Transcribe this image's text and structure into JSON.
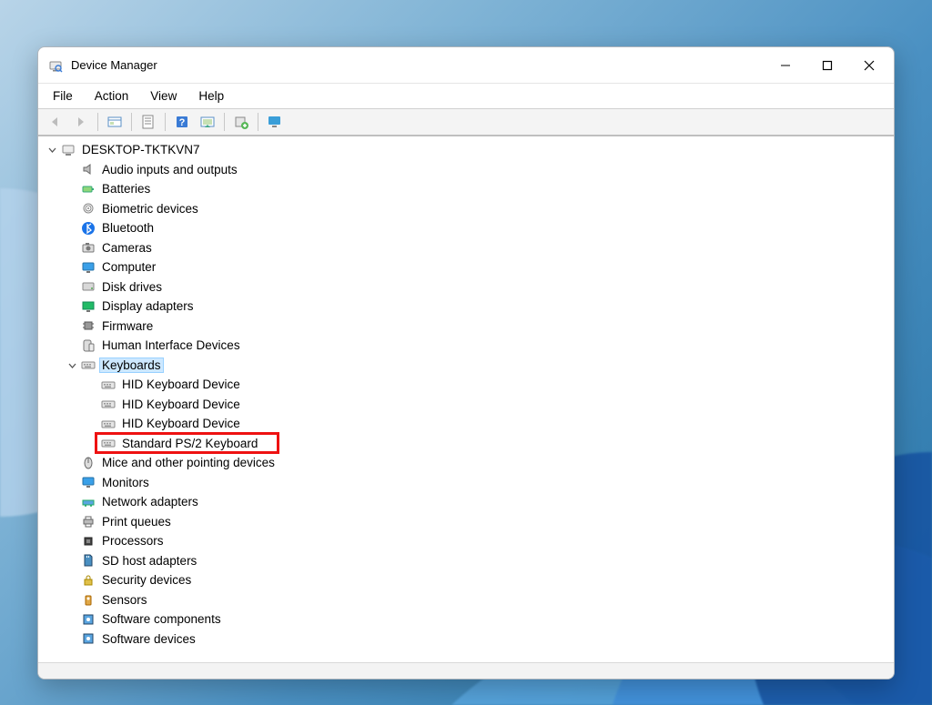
{
  "window": {
    "title": "Device Manager"
  },
  "menu": {
    "file": "File",
    "action": "Action",
    "view": "View",
    "help": "Help"
  },
  "toolbar": {
    "back": "back",
    "forward": "forward",
    "show_hidden": "show-hidden",
    "properties": "properties",
    "help": "help",
    "scan": "scan-hardware-changes",
    "add_driver": "add-driver",
    "monitor": "remote-monitor"
  },
  "tree": {
    "root": {
      "label": "DESKTOP-TKTKVN7",
      "expanded": true,
      "children": [
        {
          "label": "Audio inputs and outputs",
          "icon": "speaker",
          "expanded": false
        },
        {
          "label": "Batteries",
          "icon": "battery",
          "expanded": false
        },
        {
          "label": "Biometric devices",
          "icon": "fingerprint",
          "expanded": false
        },
        {
          "label": "Bluetooth",
          "icon": "bluetooth",
          "expanded": false
        },
        {
          "label": "Cameras",
          "icon": "camera",
          "expanded": false
        },
        {
          "label": "Computer",
          "icon": "monitor",
          "expanded": false
        },
        {
          "label": "Disk drives",
          "icon": "disk",
          "expanded": false
        },
        {
          "label": "Display adapters",
          "icon": "display",
          "expanded": false
        },
        {
          "label": "Firmware",
          "icon": "chip",
          "expanded": false
        },
        {
          "label": "Human Interface Devices",
          "icon": "hid",
          "expanded": false
        },
        {
          "label": "Keyboards",
          "icon": "keyboard",
          "expanded": true,
          "selected": true,
          "children": [
            {
              "label": "HID Keyboard Device",
              "icon": "keyboard"
            },
            {
              "label": "HID Keyboard Device",
              "icon": "keyboard"
            },
            {
              "label": "HID Keyboard Device",
              "icon": "keyboard"
            },
            {
              "label": "Standard PS/2 Keyboard",
              "icon": "keyboard",
              "highlighted": true
            }
          ]
        },
        {
          "label": "Mice and other pointing devices",
          "icon": "mouse",
          "expanded": false
        },
        {
          "label": "Monitors",
          "icon": "monitor",
          "expanded": false
        },
        {
          "label": "Network adapters",
          "icon": "network",
          "expanded": false
        },
        {
          "label": "Print queues",
          "icon": "printer",
          "expanded": false
        },
        {
          "label": "Processors",
          "icon": "cpu",
          "expanded": false
        },
        {
          "label": "SD host adapters",
          "icon": "sd",
          "expanded": false
        },
        {
          "label": "Security devices",
          "icon": "lock",
          "expanded": false
        },
        {
          "label": "Sensors",
          "icon": "sensor",
          "expanded": false
        },
        {
          "label": "Software components",
          "icon": "software",
          "expanded": false
        },
        {
          "label": "Software devices",
          "icon": "software",
          "expanded": false
        }
      ]
    }
  }
}
